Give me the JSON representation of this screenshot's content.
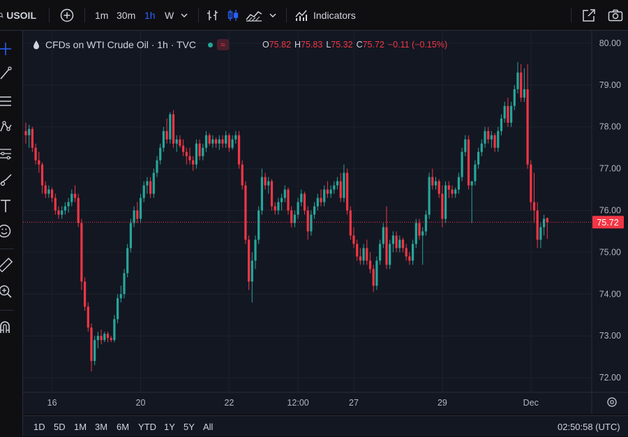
{
  "toolbar": {
    "symbol": "USOIL",
    "intervals": [
      "1m",
      "30m",
      "1h",
      "W"
    ],
    "active_interval": "1h",
    "indicators_label": "Indicators"
  },
  "legend": {
    "title": "CFDs on WTI Crude Oil · 1h · TVC",
    "badge": "≈",
    "open_key": "O",
    "open": "75.82",
    "high_key": "H",
    "high": "75.83",
    "low_key": "L",
    "low": "75.32",
    "close_key": "C",
    "close": "75.72",
    "change": "−0.11 (−0.15%)"
  },
  "bottom": {
    "ranges": [
      "1D",
      "5D",
      "1M",
      "3M",
      "6M",
      "YTD",
      "1Y",
      "5Y",
      "All"
    ],
    "clock": "02:50:58 (UTC)"
  },
  "colors": {
    "up": "#26a69a",
    "down": "#f23645",
    "background": "#131722",
    "grid": "#1e222d",
    "price_label": "#f23645"
  },
  "chart_data": {
    "type": "candlestick",
    "title": "CFDs on WTI Crude Oil · 1h · TVC",
    "ylim": [
      71.65,
      80.3
    ],
    "y_ticks": [
      72.0,
      73.0,
      74.0,
      75.0,
      76.0,
      77.0,
      78.0,
      79.0,
      80.0
    ],
    "x_tick_labels": [
      {
        "label": "16",
        "index": 8
      },
      {
        "label": "20",
        "index": 35
      },
      {
        "label": "22",
        "index": 62
      },
      {
        "label": "12:00",
        "index": 83
      },
      {
        "label": "27",
        "index": 100
      },
      {
        "label": "29",
        "index": 127
      },
      {
        "label": "Dec",
        "index": 154
      }
    ],
    "last_price": 75.72,
    "last_price_label": "75.72",
    "grid": true,
    "candles": [
      {
        "o": 77.9,
        "h": 78.1,
        "l": 77.6,
        "c": 77.8
      },
      {
        "o": 77.8,
        "h": 78.05,
        "l": 77.5,
        "c": 77.95
      },
      {
        "o": 77.95,
        "h": 78.0,
        "l": 77.4,
        "c": 77.5
      },
      {
        "o": 77.5,
        "h": 77.6,
        "l": 77.1,
        "c": 77.2
      },
      {
        "o": 77.2,
        "h": 77.4,
        "l": 76.9,
        "c": 77.1
      },
      {
        "o": 77.1,
        "h": 77.15,
        "l": 76.4,
        "c": 76.6
      },
      {
        "o": 76.6,
        "h": 76.7,
        "l": 76.3,
        "c": 76.4
      },
      {
        "o": 76.4,
        "h": 76.6,
        "l": 76.3,
        "c": 76.5
      },
      {
        "o": 76.5,
        "h": 76.55,
        "l": 76.2,
        "c": 76.3
      },
      {
        "o": 76.3,
        "h": 76.4,
        "l": 75.9,
        "c": 76.0
      },
      {
        "o": 76.0,
        "h": 76.1,
        "l": 75.8,
        "c": 75.9
      },
      {
        "o": 75.9,
        "h": 76.1,
        "l": 75.8,
        "c": 76.0
      },
      {
        "o": 76.0,
        "h": 76.2,
        "l": 75.9,
        "c": 76.1
      },
      {
        "o": 76.1,
        "h": 76.3,
        "l": 75.95,
        "c": 76.2
      },
      {
        "o": 76.2,
        "h": 76.5,
        "l": 76.1,
        "c": 76.4
      },
      {
        "o": 76.4,
        "h": 76.6,
        "l": 76.2,
        "c": 76.3
      },
      {
        "o": 76.3,
        "h": 76.4,
        "l": 75.6,
        "c": 75.7
      },
      {
        "o": 75.7,
        "h": 75.8,
        "l": 74.1,
        "c": 74.3
      },
      {
        "o": 74.3,
        "h": 74.4,
        "l": 73.6,
        "c": 73.7
      },
      {
        "o": 73.7,
        "h": 73.8,
        "l": 73.1,
        "c": 73.2
      },
      {
        "o": 73.2,
        "h": 73.3,
        "l": 72.15,
        "c": 72.4
      },
      {
        "o": 72.4,
        "h": 73.0,
        "l": 72.3,
        "c": 72.9
      },
      {
        "o": 72.9,
        "h": 73.1,
        "l": 72.7,
        "c": 73.0
      },
      {
        "o": 73.0,
        "h": 73.15,
        "l": 72.8,
        "c": 72.9
      },
      {
        "o": 72.9,
        "h": 73.1,
        "l": 72.85,
        "c": 73.05
      },
      {
        "o": 73.05,
        "h": 73.1,
        "l": 72.85,
        "c": 72.95
      },
      {
        "o": 72.95,
        "h": 73.0,
        "l": 72.85,
        "c": 72.9
      },
      {
        "o": 72.9,
        "h": 73.5,
        "l": 72.85,
        "c": 73.4
      },
      {
        "o": 73.4,
        "h": 74.0,
        "l": 73.3,
        "c": 73.9
      },
      {
        "o": 73.9,
        "h": 74.2,
        "l": 73.8,
        "c": 74.0
      },
      {
        "o": 74.0,
        "h": 74.6,
        "l": 73.9,
        "c": 74.5
      },
      {
        "o": 74.5,
        "h": 75.2,
        "l": 74.4,
        "c": 75.1
      },
      {
        "o": 75.1,
        "h": 75.8,
        "l": 75.0,
        "c": 75.7
      },
      {
        "o": 75.7,
        "h": 76.1,
        "l": 75.6,
        "c": 76.0
      },
      {
        "o": 76.0,
        "h": 76.2,
        "l": 75.7,
        "c": 75.8
      },
      {
        "o": 75.8,
        "h": 76.4,
        "l": 75.7,
        "c": 76.3
      },
      {
        "o": 76.3,
        "h": 76.7,
        "l": 76.2,
        "c": 76.6
      },
      {
        "o": 76.6,
        "h": 76.8,
        "l": 76.4,
        "c": 76.7
      },
      {
        "o": 76.7,
        "h": 76.8,
        "l": 76.3,
        "c": 76.4
      },
      {
        "o": 76.4,
        "h": 77.0,
        "l": 76.3,
        "c": 76.9
      },
      {
        "o": 76.9,
        "h": 77.3,
        "l": 76.8,
        "c": 77.2
      },
      {
        "o": 77.2,
        "h": 77.6,
        "l": 77.1,
        "c": 77.5
      },
      {
        "o": 77.5,
        "h": 78.0,
        "l": 77.4,
        "c": 77.9
      },
      {
        "o": 77.9,
        "h": 78.2,
        "l": 77.6,
        "c": 77.7
      },
      {
        "o": 77.7,
        "h": 78.35,
        "l": 77.6,
        "c": 78.3
      },
      {
        "o": 78.3,
        "h": 78.4,
        "l": 77.5,
        "c": 77.6
      },
      {
        "o": 77.6,
        "h": 77.8,
        "l": 77.4,
        "c": 77.7
      },
      {
        "o": 77.7,
        "h": 77.8,
        "l": 77.5,
        "c": 77.55
      },
      {
        "o": 77.55,
        "h": 77.7,
        "l": 77.3,
        "c": 77.4
      },
      {
        "o": 77.4,
        "h": 77.5,
        "l": 77.1,
        "c": 77.3
      },
      {
        "o": 77.3,
        "h": 77.5,
        "l": 77.1,
        "c": 77.2
      },
      {
        "o": 77.2,
        "h": 77.3,
        "l": 76.95,
        "c": 77.1
      },
      {
        "o": 77.1,
        "h": 77.7,
        "l": 77.0,
        "c": 77.6
      },
      {
        "o": 77.6,
        "h": 77.7,
        "l": 77.2,
        "c": 77.3
      },
      {
        "o": 77.3,
        "h": 77.6,
        "l": 77.2,
        "c": 77.5
      },
      {
        "o": 77.5,
        "h": 77.9,
        "l": 77.4,
        "c": 77.8
      },
      {
        "o": 77.8,
        "h": 77.85,
        "l": 77.55,
        "c": 77.6
      },
      {
        "o": 77.6,
        "h": 77.8,
        "l": 77.5,
        "c": 77.7
      },
      {
        "o": 77.7,
        "h": 77.75,
        "l": 77.5,
        "c": 77.6
      },
      {
        "o": 77.6,
        "h": 77.8,
        "l": 77.45,
        "c": 77.7
      },
      {
        "o": 77.7,
        "h": 77.8,
        "l": 77.5,
        "c": 77.6
      },
      {
        "o": 77.6,
        "h": 77.9,
        "l": 77.5,
        "c": 77.8
      },
      {
        "o": 77.8,
        "h": 77.85,
        "l": 77.4,
        "c": 77.5
      },
      {
        "o": 77.5,
        "h": 77.8,
        "l": 77.45,
        "c": 77.7
      },
      {
        "o": 77.7,
        "h": 77.9,
        "l": 77.6,
        "c": 77.8
      },
      {
        "o": 77.8,
        "h": 77.9,
        "l": 77.0,
        "c": 77.1
      },
      {
        "o": 77.1,
        "h": 77.2,
        "l": 76.5,
        "c": 76.6
      },
      {
        "o": 76.6,
        "h": 76.7,
        "l": 75.2,
        "c": 75.3
      },
      {
        "o": 75.3,
        "h": 75.4,
        "l": 74.1,
        "c": 74.3
      },
      {
        "o": 74.3,
        "h": 75.0,
        "l": 73.8,
        "c": 74.8
      },
      {
        "o": 74.8,
        "h": 75.4,
        "l": 74.6,
        "c": 75.3
      },
      {
        "o": 75.3,
        "h": 76.1,
        "l": 75.2,
        "c": 76.0
      },
      {
        "o": 76.0,
        "h": 77.0,
        "l": 75.9,
        "c": 76.8
      },
      {
        "o": 76.8,
        "h": 76.9,
        "l": 76.5,
        "c": 76.6
      },
      {
        "o": 76.6,
        "h": 76.8,
        "l": 76.4,
        "c": 76.7
      },
      {
        "o": 76.7,
        "h": 76.75,
        "l": 76.0,
        "c": 76.1
      },
      {
        "o": 76.1,
        "h": 76.2,
        "l": 75.9,
        "c": 76.0
      },
      {
        "o": 76.0,
        "h": 76.3,
        "l": 75.9,
        "c": 76.2
      },
      {
        "o": 76.2,
        "h": 76.4,
        "l": 76.0,
        "c": 76.3
      },
      {
        "o": 76.3,
        "h": 76.6,
        "l": 76.2,
        "c": 76.5
      },
      {
        "o": 76.5,
        "h": 76.55,
        "l": 75.9,
        "c": 76.0
      },
      {
        "o": 76.0,
        "h": 76.1,
        "l": 75.6,
        "c": 75.7
      },
      {
        "o": 75.7,
        "h": 76.0,
        "l": 75.6,
        "c": 75.9
      },
      {
        "o": 75.9,
        "h": 76.3,
        "l": 75.8,
        "c": 76.2
      },
      {
        "o": 76.2,
        "h": 76.5,
        "l": 76.1,
        "c": 76.4
      },
      {
        "o": 76.4,
        "h": 76.45,
        "l": 75.9,
        "c": 76.0
      },
      {
        "o": 76.0,
        "h": 76.1,
        "l": 75.3,
        "c": 75.5
      },
      {
        "o": 75.5,
        "h": 76.0,
        "l": 75.4,
        "c": 75.9
      },
      {
        "o": 75.9,
        "h": 76.2,
        "l": 75.8,
        "c": 76.1
      },
      {
        "o": 76.1,
        "h": 76.4,
        "l": 76.0,
        "c": 76.3
      },
      {
        "o": 76.3,
        "h": 76.5,
        "l": 76.1,
        "c": 76.2
      },
      {
        "o": 76.2,
        "h": 76.6,
        "l": 76.1,
        "c": 76.5
      },
      {
        "o": 76.5,
        "h": 76.7,
        "l": 76.3,
        "c": 76.4
      },
      {
        "o": 76.4,
        "h": 76.6,
        "l": 76.3,
        "c": 76.5
      },
      {
        "o": 76.5,
        "h": 76.7,
        "l": 76.4,
        "c": 76.6
      },
      {
        "o": 76.6,
        "h": 76.8,
        "l": 76.5,
        "c": 76.7
      },
      {
        "o": 76.7,
        "h": 76.9,
        "l": 76.2,
        "c": 76.3
      },
      {
        "o": 76.3,
        "h": 77.1,
        "l": 76.2,
        "c": 76.9
      },
      {
        "o": 76.9,
        "h": 77.0,
        "l": 75.9,
        "c": 76.0
      },
      {
        "o": 76.0,
        "h": 76.1,
        "l": 75.3,
        "c": 75.4
      },
      {
        "o": 75.4,
        "h": 75.6,
        "l": 75.1,
        "c": 75.2
      },
      {
        "o": 75.2,
        "h": 75.3,
        "l": 74.8,
        "c": 74.9
      },
      {
        "o": 74.9,
        "h": 75.1,
        "l": 74.7,
        "c": 74.8
      },
      {
        "o": 74.8,
        "h": 75.2,
        "l": 74.7,
        "c": 75.1
      },
      {
        "o": 75.1,
        "h": 75.3,
        "l": 74.7,
        "c": 74.8
      },
      {
        "o": 74.8,
        "h": 75.0,
        "l": 74.5,
        "c": 74.6
      },
      {
        "o": 74.6,
        "h": 74.7,
        "l": 74.05,
        "c": 74.2
      },
      {
        "o": 74.2,
        "h": 74.9,
        "l": 74.1,
        "c": 74.8
      },
      {
        "o": 74.8,
        "h": 75.3,
        "l": 74.7,
        "c": 75.2
      },
      {
        "o": 75.2,
        "h": 75.7,
        "l": 75.1,
        "c": 75.6
      },
      {
        "o": 75.6,
        "h": 76.1,
        "l": 74.6,
        "c": 74.7
      },
      {
        "o": 74.7,
        "h": 75.3,
        "l": 74.6,
        "c": 75.2
      },
      {
        "o": 75.2,
        "h": 75.5,
        "l": 75.0,
        "c": 75.4
      },
      {
        "o": 75.4,
        "h": 75.5,
        "l": 75.0,
        "c": 75.1
      },
      {
        "o": 75.1,
        "h": 75.4,
        "l": 75.0,
        "c": 75.3
      },
      {
        "o": 75.3,
        "h": 75.35,
        "l": 75.0,
        "c": 75.1
      },
      {
        "o": 75.1,
        "h": 75.2,
        "l": 74.8,
        "c": 74.9
      },
      {
        "o": 74.9,
        "h": 75.0,
        "l": 74.7,
        "c": 74.8
      },
      {
        "o": 74.8,
        "h": 75.3,
        "l": 74.7,
        "c": 75.2
      },
      {
        "o": 75.2,
        "h": 75.8,
        "l": 75.1,
        "c": 75.7
      },
      {
        "o": 75.7,
        "h": 75.8,
        "l": 75.3,
        "c": 75.4
      },
      {
        "o": 75.4,
        "h": 75.6,
        "l": 74.7,
        "c": 75.5
      },
      {
        "o": 75.5,
        "h": 76.0,
        "l": 75.4,
        "c": 75.9
      },
      {
        "o": 75.9,
        "h": 76.9,
        "l": 75.8,
        "c": 76.8
      },
      {
        "o": 76.8,
        "h": 77.0,
        "l": 76.5,
        "c": 76.6
      },
      {
        "o": 76.6,
        "h": 76.8,
        "l": 76.5,
        "c": 76.7
      },
      {
        "o": 76.7,
        "h": 76.75,
        "l": 76.3,
        "c": 76.4
      },
      {
        "o": 76.4,
        "h": 76.6,
        "l": 75.6,
        "c": 75.8
      },
      {
        "o": 75.8,
        "h": 76.7,
        "l": 75.7,
        "c": 76.6
      },
      {
        "o": 76.6,
        "h": 76.7,
        "l": 76.3,
        "c": 76.5
      },
      {
        "o": 76.5,
        "h": 76.6,
        "l": 76.3,
        "c": 76.4
      },
      {
        "o": 76.4,
        "h": 76.55,
        "l": 76.3,
        "c": 76.5
      },
      {
        "o": 76.5,
        "h": 76.9,
        "l": 76.4,
        "c": 76.8
      },
      {
        "o": 76.8,
        "h": 77.5,
        "l": 76.7,
        "c": 77.4
      },
      {
        "o": 77.4,
        "h": 77.8,
        "l": 77.3,
        "c": 77.7
      },
      {
        "o": 77.7,
        "h": 77.8,
        "l": 76.5,
        "c": 76.6
      },
      {
        "o": 76.6,
        "h": 76.7,
        "l": 75.7,
        "c": 76.7
      },
      {
        "o": 76.7,
        "h": 77.2,
        "l": 76.6,
        "c": 77.1
      },
      {
        "o": 77.1,
        "h": 77.5,
        "l": 77.0,
        "c": 77.4
      },
      {
        "o": 77.4,
        "h": 77.7,
        "l": 77.3,
        "c": 77.6
      },
      {
        "o": 77.6,
        "h": 78.0,
        "l": 77.5,
        "c": 77.9
      },
      {
        "o": 77.9,
        "h": 78.0,
        "l": 77.6,
        "c": 77.7
      },
      {
        "o": 77.7,
        "h": 77.9,
        "l": 77.5,
        "c": 77.8
      },
      {
        "o": 77.8,
        "h": 77.85,
        "l": 77.4,
        "c": 77.5
      },
      {
        "o": 77.5,
        "h": 78.0,
        "l": 77.4,
        "c": 77.9
      },
      {
        "o": 77.9,
        "h": 78.3,
        "l": 77.8,
        "c": 78.2
      },
      {
        "o": 78.2,
        "h": 78.6,
        "l": 78.1,
        "c": 78.5
      },
      {
        "o": 78.5,
        "h": 78.7,
        "l": 78.0,
        "c": 78.1
      },
      {
        "o": 78.1,
        "h": 78.6,
        "l": 78.0,
        "c": 78.5
      },
      {
        "o": 78.5,
        "h": 79.0,
        "l": 78.4,
        "c": 78.9
      },
      {
        "o": 78.9,
        "h": 79.55,
        "l": 78.8,
        "c": 79.3
      },
      {
        "o": 79.3,
        "h": 79.5,
        "l": 78.6,
        "c": 78.7
      },
      {
        "o": 78.7,
        "h": 79.4,
        "l": 78.6,
        "c": 78.9
      },
      {
        "o": 78.9,
        "h": 79.5,
        "l": 77.0,
        "c": 77.1
      },
      {
        "o": 77.1,
        "h": 77.2,
        "l": 76.0,
        "c": 76.2
      },
      {
        "o": 76.2,
        "h": 76.9,
        "l": 75.7,
        "c": 76.0
      },
      {
        "o": 76.0,
        "h": 76.2,
        "l": 75.1,
        "c": 75.3
      },
      {
        "o": 75.3,
        "h": 75.7,
        "l": 75.1,
        "c": 75.6
      },
      {
        "o": 75.6,
        "h": 75.9,
        "l": 75.4,
        "c": 75.8
      },
      {
        "o": 75.82,
        "h": 75.83,
        "l": 75.32,
        "c": 75.72
      }
    ]
  }
}
